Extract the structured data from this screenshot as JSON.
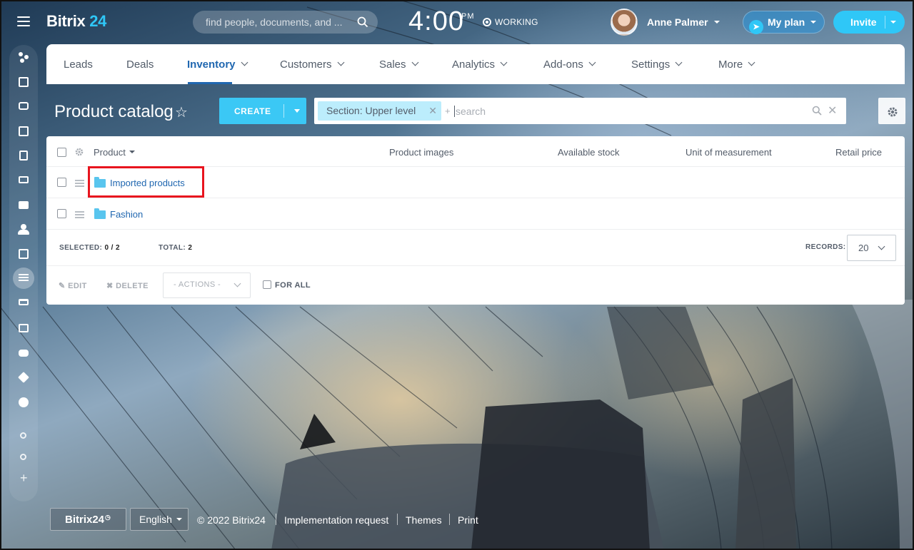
{
  "header": {
    "logo_name": "Bitrix",
    "logo_num": "24",
    "search_placeholder": "find people, documents, and ...",
    "time": "4:00",
    "time_suffix": "PM",
    "status": "WORKING",
    "user_name": "Anne Palmer",
    "plan_label": "My plan",
    "invite_label": "Invite"
  },
  "menu": [
    {
      "label": "Leads"
    },
    {
      "label": "Deals"
    },
    {
      "label": "Inventory",
      "active": true
    },
    {
      "label": "Customers"
    },
    {
      "label": "Sales"
    },
    {
      "label": "Analytics"
    },
    {
      "label": "Add-ons"
    },
    {
      "label": "Settings"
    },
    {
      "label": "More"
    }
  ],
  "page": {
    "title": "Product catalog",
    "create_label": "CREATE",
    "filter_tag": "Section: Upper level",
    "filter_plus": "+",
    "filter_placeholder": "search"
  },
  "table": {
    "columns": [
      "Product",
      "Product images",
      "Available stock",
      "Unit of measurement",
      "Retail price"
    ],
    "rows": [
      {
        "name": "Imported products",
        "type": "folder"
      },
      {
        "name": "Fashion",
        "type": "folder"
      }
    ],
    "selected_label": "SELECTED:",
    "selected_value": "0 / 2",
    "total_label": "TOTAL:",
    "total_value": "2",
    "records_label": "RECORDS:",
    "records_value": "20",
    "edit_label": "EDIT",
    "delete_label": "DELETE",
    "actions_label": "- ACTIONS -",
    "for_all_label": "FOR ALL"
  },
  "footer": {
    "logo": "Bitrix24",
    "language": "English",
    "copyright": "© 2022 Bitrix24",
    "links": [
      "Implementation request",
      "Themes",
      "Print"
    ]
  },
  "colors": {
    "accent": "#2fc7f7",
    "link": "#2067b0",
    "highlight": "#e8141e"
  }
}
